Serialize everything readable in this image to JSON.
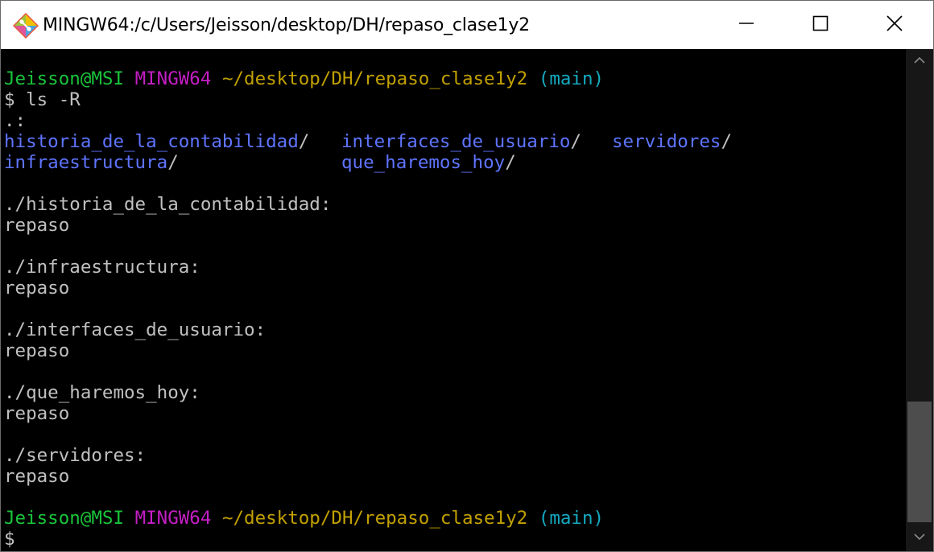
{
  "window": {
    "title": "MINGW64:/c/Users/Jeisson/desktop/DH/repaso_clase1y2",
    "icon": "git-bash-icon"
  },
  "controls": {
    "minimize": "minimize-icon",
    "maximize": "maximize-icon",
    "close": "close-icon"
  },
  "colors": {
    "user_host": "#19c43a",
    "shell": "#c51ec5",
    "path": "#c1a000",
    "branch": "#15a9c0",
    "directory": "#5f74ff",
    "text": "#c0c0c0",
    "background": "#000000"
  },
  "prompt1": {
    "user": "Jeisson@MSI",
    "shell": "MINGW64",
    "path": "~/desktop/DH/repaso_clase1y2",
    "branch": "(main)"
  },
  "command": "$ ls -R",
  "root_heading": ".:",
  "listing": {
    "d1": "historia_de_la_contabilidad",
    "d2": "interfaces_de_usuario",
    "d3": "servidores",
    "d4": "infraestructura",
    "d5": "que_haremos_hoy",
    "slash": "/"
  },
  "sections": [
    {
      "heading": "./historia_de_la_contabilidad:",
      "content": "repaso"
    },
    {
      "heading": "./infraestructura:",
      "content": "repaso"
    },
    {
      "heading": "./interfaces_de_usuario:",
      "content": "repaso"
    },
    {
      "heading": "./que_haremos_hoy:",
      "content": "repaso"
    },
    {
      "heading": "./servidores:",
      "content": "repaso"
    }
  ],
  "prompt2": {
    "user": "Jeisson@MSI",
    "shell": "MINGW64",
    "path": "~/desktop/DH/repaso_clase1y2",
    "branch": "(main)"
  },
  "cursor_line": "$"
}
